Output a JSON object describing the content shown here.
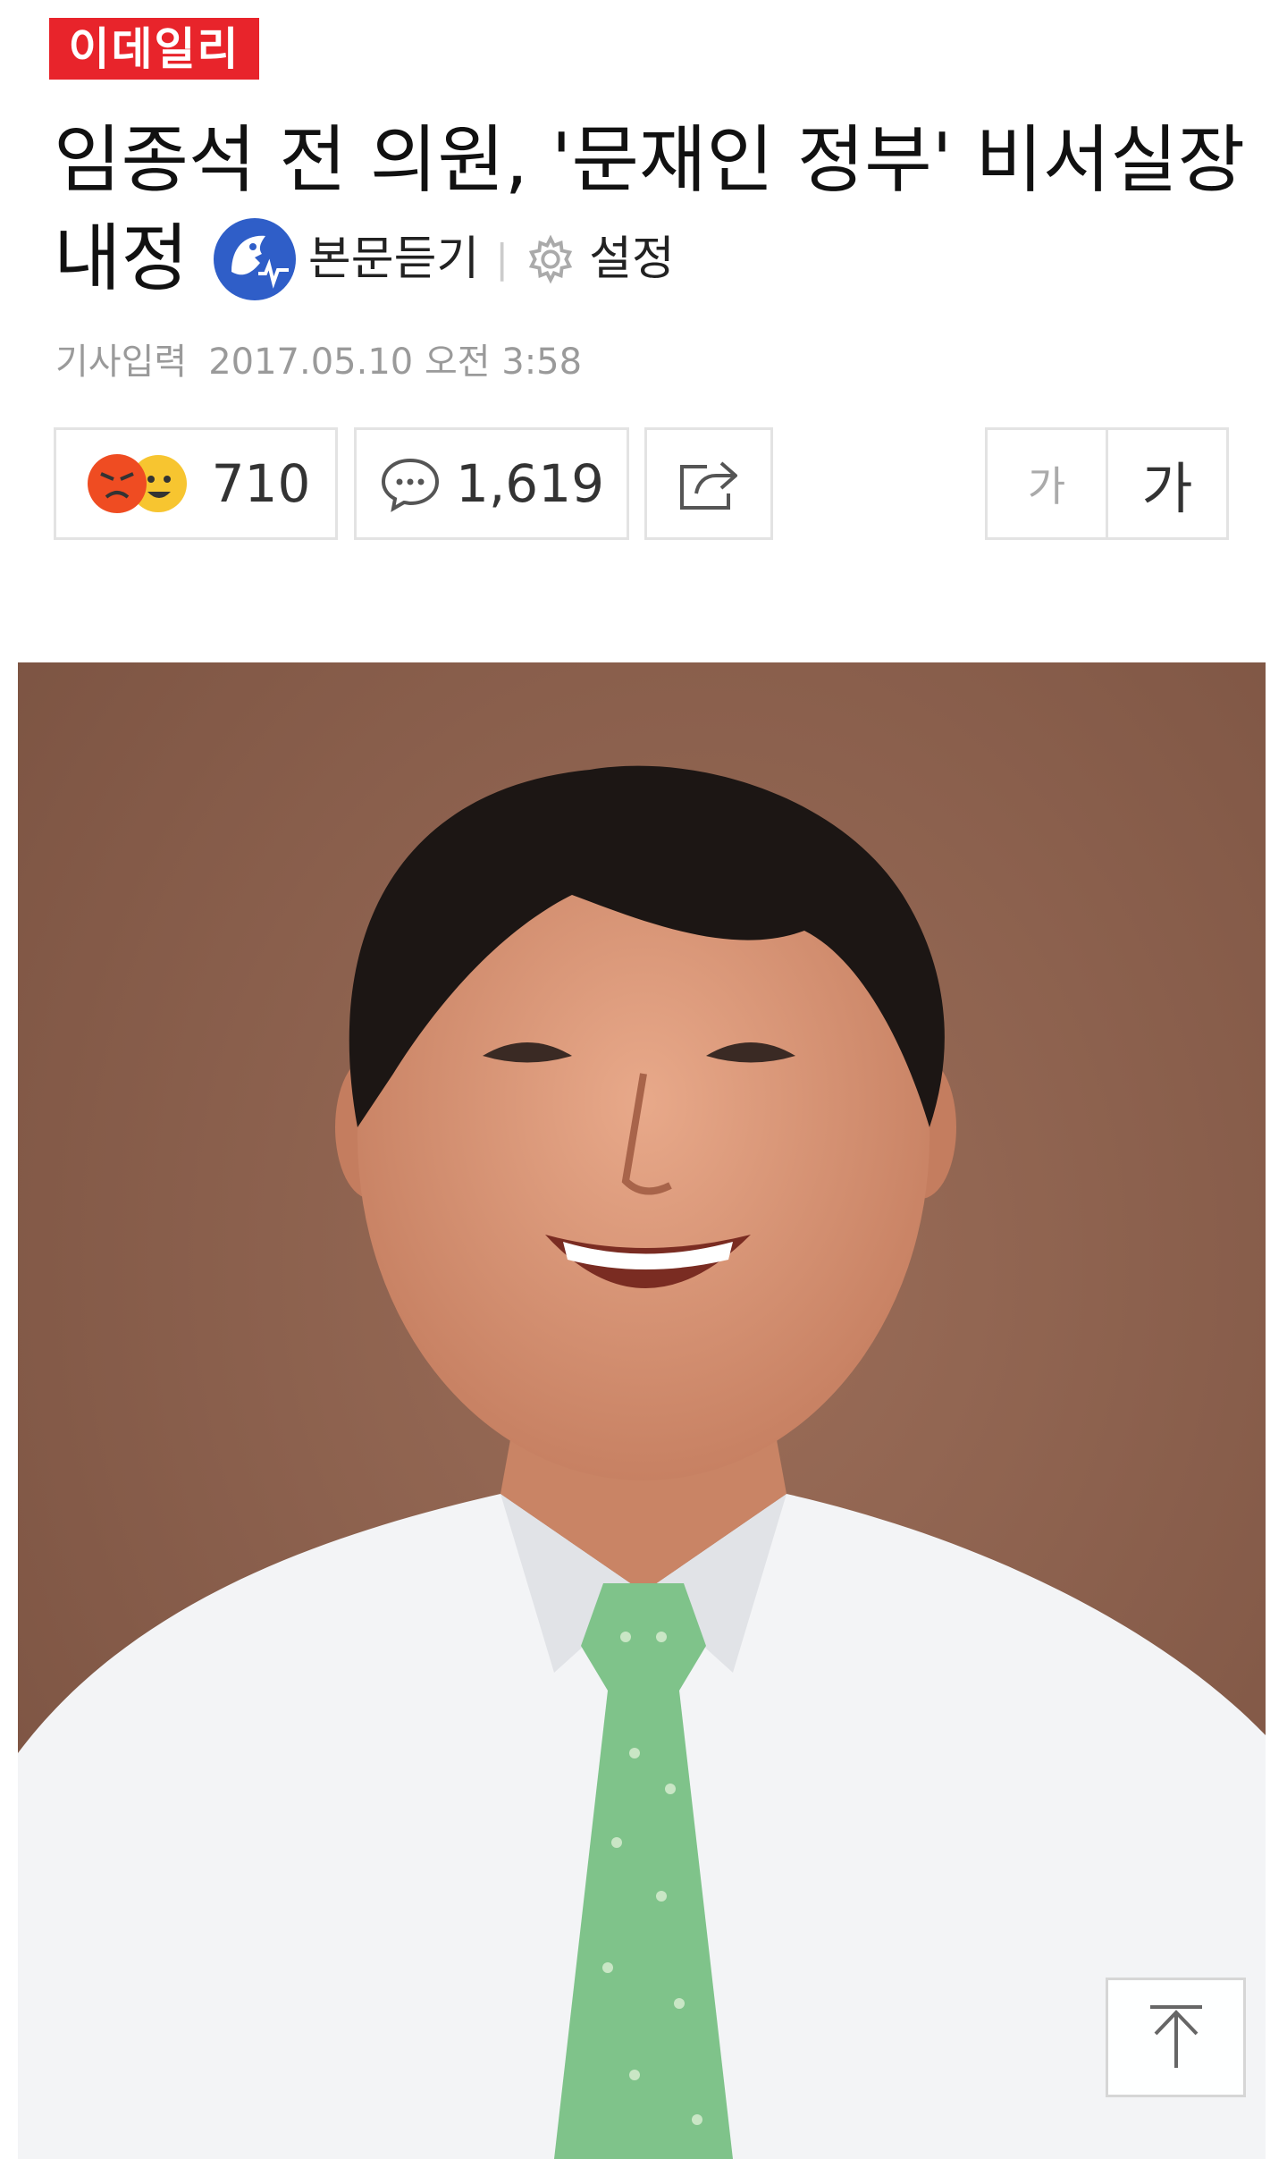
{
  "logo": {
    "text": "이데일리",
    "bg_color": "#e8242b"
  },
  "headline": {
    "line1": "임종석 전 의원, '문재인 정부' 비서실장",
    "line2": "내정"
  },
  "tools": {
    "listen_label": "본문듣기",
    "separator": "|",
    "settings_label": "설정"
  },
  "meta": {
    "label": "기사입력",
    "datetime": "2017.05.10 오전 3:58"
  },
  "actions": {
    "reaction_count": "710",
    "comment_count": "1,619",
    "font_small_label": "가",
    "font_large_label": "가"
  },
  "colors": {
    "accent": "#e8242b",
    "listen_blue": "#2f5ec8",
    "photo_bg": "#8a5e4c",
    "tie_green": "#7fc38a"
  },
  "icons": {
    "listen": "speaker-face-icon",
    "settings": "gear-icon",
    "comment": "speech-bubble-icon",
    "share": "share-arrow-icon",
    "top": "arrow-up-icon"
  }
}
